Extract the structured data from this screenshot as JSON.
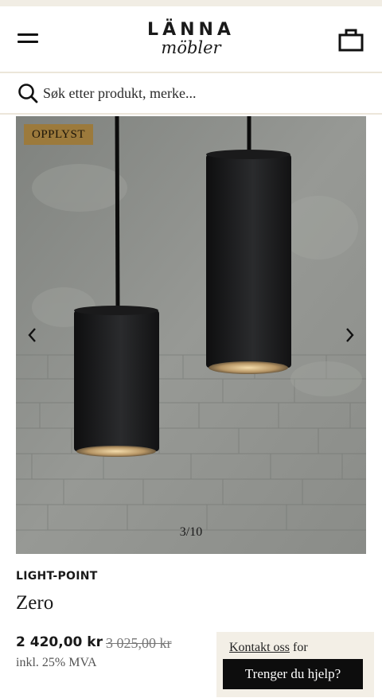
{
  "header": {
    "brand": "LÄNNA",
    "brand_sub": "möbler",
    "menu_icon": "hamburger-menu-icon",
    "cart_icon": "shopping-bag-icon"
  },
  "search": {
    "placeholder": "Søk etter produkt, merke...",
    "icon": "search-icon"
  },
  "gallery": {
    "badge": "OPPLYST",
    "counter": "3/10",
    "prev_icon": "chevron-left-icon",
    "next_icon": "chevron-right-icon"
  },
  "product": {
    "brand": "LIGHT-POINT",
    "name": "Zero",
    "price": "2 420,00 kr",
    "old_price": "3 025,00 kr",
    "vat_note": "inkl. 25% MVA"
  },
  "help": {
    "link": "Kontakt oss",
    "text": " for",
    "button": "Trenger du hjelp?"
  },
  "colors": {
    "badge_bg": "#9c7a3c",
    "help_bg": "#f3efe6",
    "button_bg": "#0d0d0d"
  }
}
